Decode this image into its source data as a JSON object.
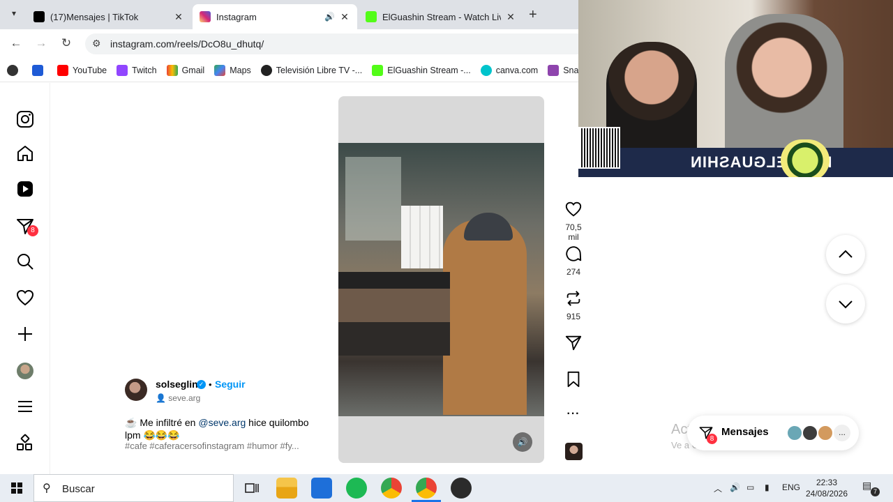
{
  "browser": {
    "tabs": [
      {
        "title": "(17)Mensajes | TikTok",
        "active": false
      },
      {
        "title": "Instagram",
        "active": true
      },
      {
        "title": "ElGuashin Stream - Watch Live o",
        "active": false
      }
    ],
    "new_tab_label": "+",
    "url": "instagram.com/reels/DcO8u_dhutq/",
    "bookmarks": [
      {
        "label": ""
      },
      {
        "label": ""
      },
      {
        "label": "YouTube"
      },
      {
        "label": "Twitch"
      },
      {
        "label": "Gmail"
      },
      {
        "label": "Maps"
      },
      {
        "label": "Televisión Libre TV -..."
      },
      {
        "label": "ElGuashin Stream -..."
      },
      {
        "label": "canva.com"
      },
      {
        "label": "SnapIns"
      }
    ]
  },
  "sidebar": {
    "notifications_badge": "8"
  },
  "reel": {
    "likes": "70,5 mil",
    "comments": "274",
    "reposts": "915",
    "author": {
      "username": "solseglin",
      "separator": "•",
      "follow_label": "Seguir",
      "sub_account": "seve.arg"
    },
    "caption_emoji_lead": "☕",
    "caption_text_before": " Me infiltré en ",
    "caption_mention": "@seve.arg",
    "caption_text_after": " hice quilombo lpm 😂😂😂",
    "hashtags": "#cafe #caferacersofinstagram #humor #fy..."
  },
  "stream_overlay": {
    "banner_text": "KICK ELGUASHIN"
  },
  "messages_widget": {
    "label": "Mensajes",
    "badge": "8",
    "more": "..."
  },
  "windows_watermark": {
    "line1": "Activar Windows",
    "line2": "Ve a Configuración para activar Windows."
  },
  "taskbar": {
    "search_placeholder": "Buscar",
    "language": "ENG",
    "time": "22:33",
    "date": "24/08/2026",
    "notification_count": "7"
  },
  "colors": {
    "instagram_blue": "#0095f6",
    "badge_red": "#ff3040",
    "chrome_tabstrip": "#dee1e6"
  }
}
